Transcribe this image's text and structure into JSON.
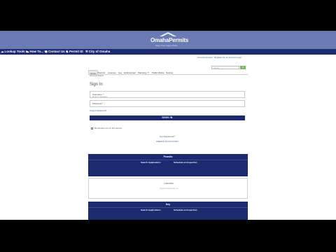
{
  "header": {
    "logo_name": "OmahaPermits",
    "logo_tagline": "Save Time Apply Online"
  },
  "nav": {
    "items": [
      {
        "label": "Lookup Tools",
        "icon": "cloud-icon"
      },
      {
        "label": "How To...",
        "icon": "cloud-icon"
      },
      {
        "label": "Contact Us",
        "icon": "globe-icon"
      },
      {
        "label": "Permit ID",
        "icon": "person-icon"
      },
      {
        "label": "City of Omaha",
        "icon": "gear-icon"
      }
    ]
  },
  "utility": {
    "announcements": "Announcements",
    "register": "Register for an Account",
    "login": "Login"
  },
  "tabs": {
    "items": [
      "Home",
      "Permits",
      "Licenses",
      "Key",
      "Enforcement",
      "Planning / ?",
      "Public Works",
      "Notices"
    ],
    "sub": "Advanced Search",
    "search_placeholder": "Search",
    "search_button": "Q"
  },
  "signin": {
    "title": "Sign In",
    "username_label": "Username",
    "username_hint": "Email or Username",
    "password_label": "Password",
    "forgot": "Forgot Password?",
    "button": "SIGN IN",
    "remember": "Remember me on this device",
    "not_registered": "Not Registered?",
    "create": "CREATE AN ACCOUNT"
  },
  "panels": {
    "permits": {
      "title": "Permits",
      "left": "Search Applications",
      "right": "Schedule an Inspection"
    },
    "licenses": {
      "title": "Licenses",
      "link": "Search Applications"
    },
    "key": {
      "title": "Key",
      "left": "Search Applications",
      "right": "Schedule an Inspection"
    }
  },
  "colors": {
    "header": "#6a7ab2",
    "navy": "#1c2a70",
    "link": "#2d5f9e",
    "search_button": "#7bb661"
  }
}
